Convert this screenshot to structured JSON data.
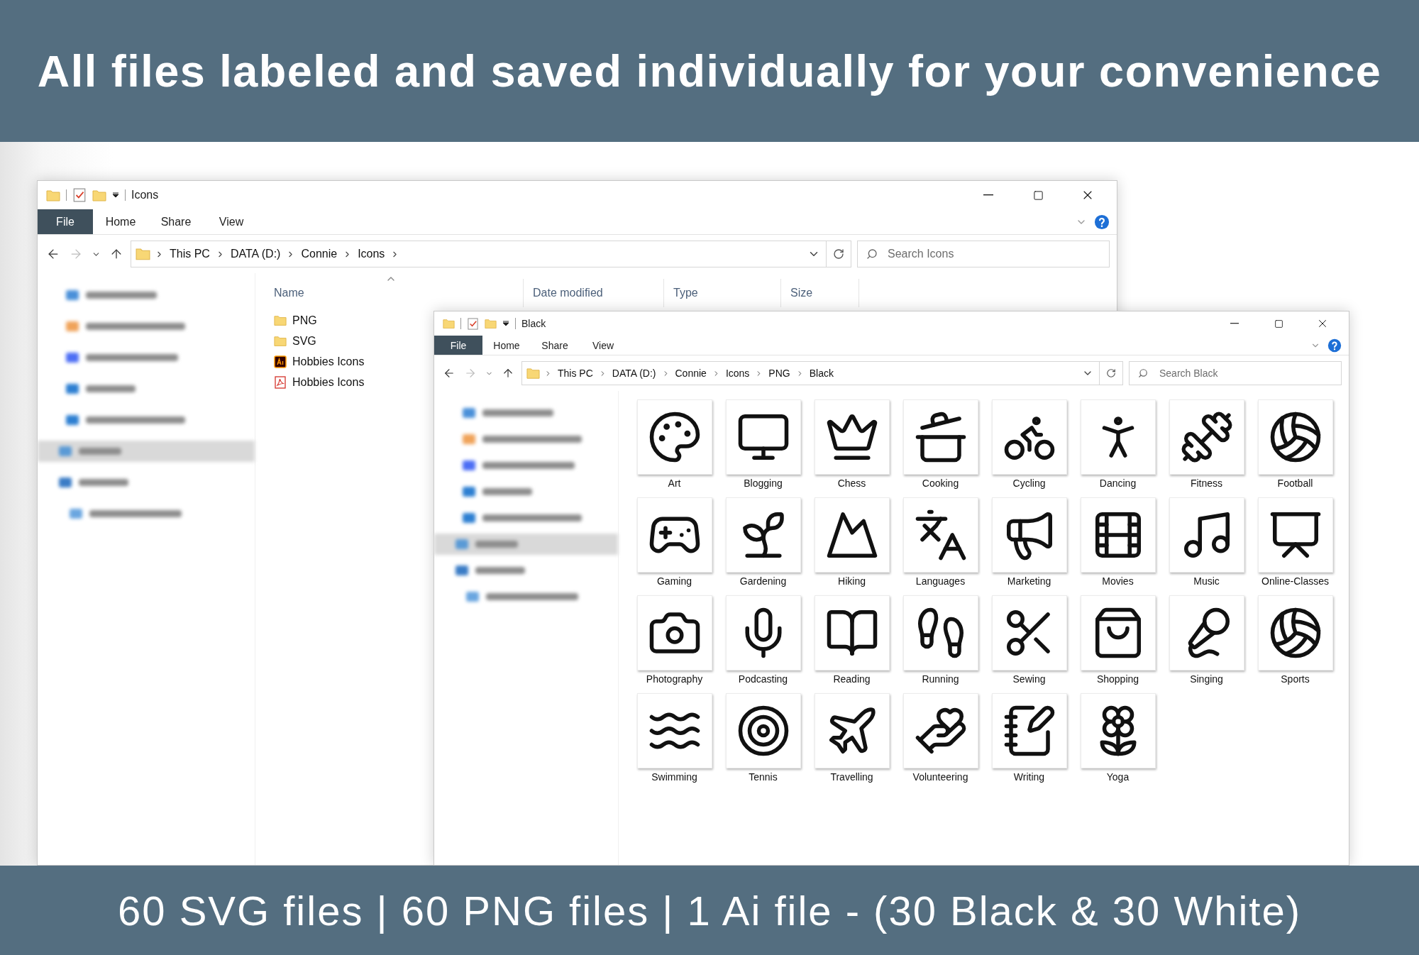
{
  "banner": {
    "title": "All files labeled and saved individually for your convenience"
  },
  "windows": [
    {
      "title": "Icons",
      "ribbon_tabs": [
        {
          "label": "File",
          "selected": true
        },
        {
          "label": "Home",
          "selected": false
        },
        {
          "label": "Share",
          "selected": false
        },
        {
          "label": "View",
          "selected": false
        }
      ],
      "breadcrumb": [
        "This PC",
        "DATA (D:)",
        "Connie",
        "Icons"
      ],
      "search": {
        "placeholder": "Search Icons"
      },
      "nav_items": [
        {
          "selected": false
        },
        {
          "selected": false
        },
        {
          "selected": false
        },
        {
          "selected": false
        },
        {
          "selected": false
        },
        {
          "selected": true
        },
        {
          "selected": false
        },
        {
          "selected": false
        }
      ],
      "columns": [
        "Name",
        "Date modified",
        "Type",
        "Size"
      ],
      "files": [
        {
          "name": "PNG",
          "kind": "folder"
        },
        {
          "name": "SVG",
          "kind": "folder"
        },
        {
          "name": "Hobbies Icons",
          "kind": "ai"
        },
        {
          "name": "Hobbies Icons",
          "kind": "pdf"
        }
      ]
    },
    {
      "title": "Black",
      "ribbon_tabs": [
        {
          "label": "File",
          "selected": true
        },
        {
          "label": "Home",
          "selected": false
        },
        {
          "label": "Share",
          "selected": false
        },
        {
          "label": "View",
          "selected": false
        }
      ],
      "breadcrumb": [
        "This PC",
        "DATA (D:)",
        "Connie",
        "Icons",
        "PNG",
        "Black"
      ],
      "search": {
        "placeholder": "Search Black"
      },
      "nav_items": [
        {
          "selected": false
        },
        {
          "selected": false
        },
        {
          "selected": false
        },
        {
          "selected": false
        },
        {
          "selected": false
        },
        {
          "selected": true
        },
        {
          "selected": false
        },
        {
          "selected": false
        }
      ],
      "icons": [
        {
          "label": "Art"
        },
        {
          "label": "Blogging"
        },
        {
          "label": "Chess"
        },
        {
          "label": "Cooking"
        },
        {
          "label": "Cycling"
        },
        {
          "label": "Dancing"
        },
        {
          "label": "Fitness"
        },
        {
          "label": "Football"
        },
        {
          "label": "Gaming"
        },
        {
          "label": "Gardening"
        },
        {
          "label": "Hiking"
        },
        {
          "label": "Languages"
        },
        {
          "label": "Marketing"
        },
        {
          "label": "Movies"
        },
        {
          "label": "Music"
        },
        {
          "label": "Online-Classes"
        },
        {
          "label": "Photography"
        },
        {
          "label": "Podcasting"
        },
        {
          "label": "Reading"
        },
        {
          "label": "Running"
        },
        {
          "label": "Sewing"
        },
        {
          "label": "Shopping"
        },
        {
          "label": "Singing"
        },
        {
          "label": "Sports"
        },
        {
          "label": "Swimming"
        },
        {
          "label": "Tennis"
        },
        {
          "label": "Travelling"
        },
        {
          "label": "Volunteering"
        },
        {
          "label": "Writing"
        },
        {
          "label": "Yoga"
        }
      ]
    }
  ],
  "footer": {
    "text": "60 SVG files | 60 PNG files | 1 Ai file - (30 Black & 30 White)"
  }
}
